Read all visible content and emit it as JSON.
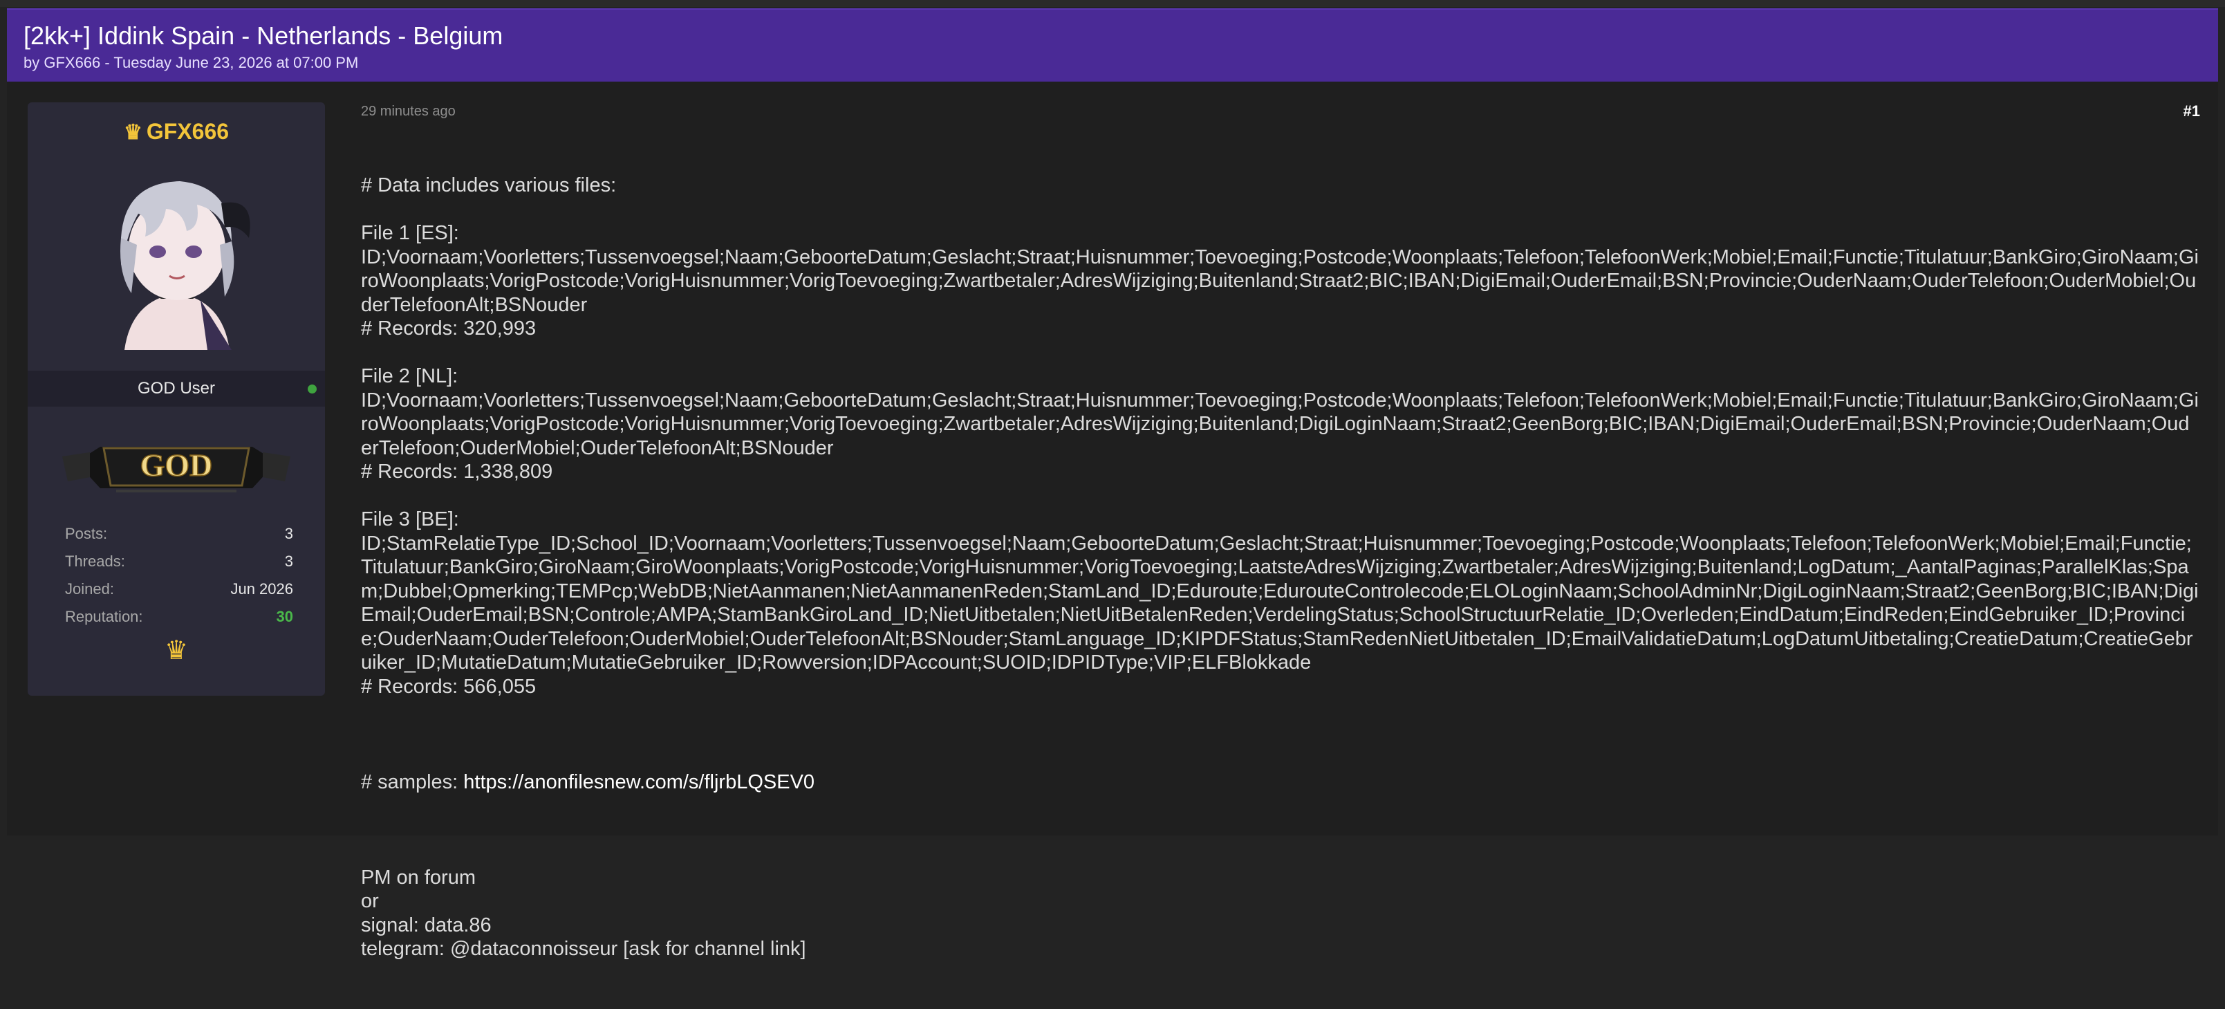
{
  "thread": {
    "title": "[2kk+] Iddink Spain - Netherlands - Belgium",
    "meta": "by GFX666 - Tuesday June 23, 2026 at 07:00 PM"
  },
  "user": {
    "name": "GFX666",
    "title": "GOD User",
    "rank_badge": "GOD",
    "stats": [
      {
        "label": "Posts:",
        "value": "3"
      },
      {
        "label": "Threads:",
        "value": "3"
      },
      {
        "label": "Joined:",
        "value": "Jun 2026"
      },
      {
        "label": "Reputation:",
        "value": "30"
      }
    ],
    "crown_icon": "crown-icon",
    "online_color": "#3fa33f"
  },
  "post": {
    "time": "29 minutes ago",
    "number": "#1",
    "lines": [
      "# Data includes various files:",
      "",
      "File 1 [ES]:",
      "ID;Voornaam;Voorletters;Tussenvoegsel;Naam;GeboorteDatum;Geslacht;Straat;Huisnummer;Toevoeging;Postcode;Woonplaats;Telefoon;TelefoonWerk;Mobiel;Email;Functie;Titulatuur;BankGiro;GiroNaam;GiroWoonplaats;VorigPostcode;VorigHuisnummer;VorigToevoeging;Zwartbetaler;AdresWijziging;Buitenland;Straat2;BIC;IBAN;DigiEmail;OuderEmail;BSN;Provincie;OuderNaam;OuderTelefoon;OuderMobiel;OuderTelefoonAlt;BSNouder",
      "# Records: 320,993",
      "",
      "File 2 [NL]:",
      "ID;Voornaam;Voorletters;Tussenvoegsel;Naam;GeboorteDatum;Geslacht;Straat;Huisnummer;Toevoeging;Postcode;Woonplaats;Telefoon;TelefoonWerk;Mobiel;Email;Functie;Titulatuur;BankGiro;GiroNaam;GiroWoonplaats;VorigPostcode;VorigHuisnummer;VorigToevoeging;Zwartbetaler;AdresWijziging;Buitenland;DigiLoginNaam;Straat2;GeenBorg;BIC;IBAN;DigiEmail;OuderEmail;BSN;Provincie;OuderNaam;OuderTelefoon;OuderMobiel;OuderTelefoonAlt;BSNouder",
      "# Records: 1,338,809",
      "",
      "File 3 [BE]:",
      "ID;StamRelatieType_ID;School_ID;Voornaam;Voorletters;Tussenvoegsel;Naam;GeboorteDatum;Geslacht;Straat;Huisnummer;Toevoeging;Postcode;Woonplaats;Telefoon;TelefoonWerk;Mobiel;Email;Functie;Titulatuur;BankGiro;GiroNaam;GiroWoonplaats;VorigPostcode;VorigHuisnummer;VorigToevoeging;LaatsteAdresWijziging;Zwartbetaler;AdresWijziging;Buitenland;LogDatum;_AantalPaginas;ParallelKlas;Spam;Dubbel;Opmerking;TEMPcp;WebDB;NietAanmanen;NietAanmanenReden;StamLand_ID;Eduroute;EdurouteControlecode;ELOLoginNaam;SchoolAdminNr;DigiLoginNaam;Straat2;GeenBorg;BIC;IBAN;DigiEmail;OuderEmail;BSN;Controle;AMPA;StamBankGiroLand_ID;NietUitbetalen;NietUitBetalenReden;VerdelingStatus;SchoolStructuurRelatie_ID;Overleden;EindDatum;EindReden;EindGebruiker_ID;Provincie;OuderNaam;OuderTelefoon;OuderMobiel;OuderTelefoonAlt;BSNouder;StamLanguage_ID;KIPDFStatus;StamRedenNietUitbetalen_ID;EmailValidatieDatum;LogDatumUitbetaling;CreatieDatum;CreatieGebruiker_ID;MutatieDatum;MutatieGebruiker_ID;Rowversion;IDPAccount;SUOID;IDPIDType;VIP;ELFBlokkade",
      "# Records: 566,055",
      ""
    ],
    "samples_label": "# samples: ",
    "samples_link": "https://anonfilesnew.com/s/fljrbLQSEV0",
    "contact_lines": [
      "",
      "PM on forum",
      "or",
      "signal: data.86",
      "telegram: @dataconnoisseur [ask for channel link]"
    ]
  }
}
